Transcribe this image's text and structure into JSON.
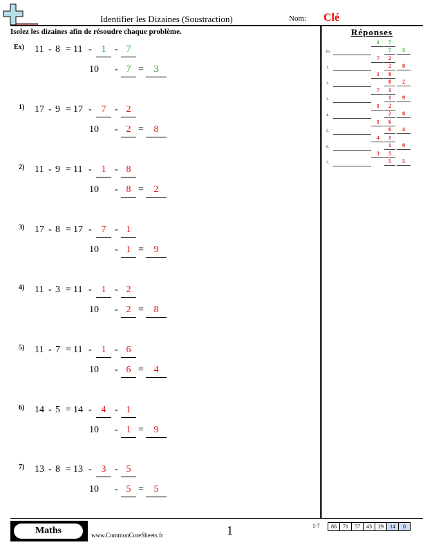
{
  "header": {
    "title": "Identifier les Dizaines (Soustraction)",
    "name_label": "Nom:",
    "name_value": "Clé",
    "logo_icon": "plus-minus-icon"
  },
  "instructions": "Isolez les dizaines afin de résoudre chaque problème.",
  "colors": {
    "example_answer": "#1aa51a",
    "key_answer": "#e01010"
  },
  "problems": [
    {
      "label": "Ex)",
      "a": "11",
      "b": "8",
      "tens_start": "11",
      "part1": "1",
      "part2": "7",
      "ten": "10",
      "result": "3",
      "example": true
    },
    {
      "label": "1)",
      "a": "17",
      "b": "9",
      "tens_start": "17",
      "part1": "7",
      "part2": "2",
      "ten": "10",
      "result": "8",
      "example": false
    },
    {
      "label": "2)",
      "a": "11",
      "b": "9",
      "tens_start": "11",
      "part1": "1",
      "part2": "8",
      "ten": "10",
      "result": "2",
      "example": false
    },
    {
      "label": "3)",
      "a": "17",
      "b": "8",
      "tens_start": "17",
      "part1": "7",
      "part2": "1",
      "ten": "10",
      "result": "9",
      "example": false
    },
    {
      "label": "4)",
      "a": "11",
      "b": "3",
      "tens_start": "11",
      "part1": "1",
      "part2": "2",
      "ten": "10",
      "result": "8",
      "example": false
    },
    {
      "label": "5)",
      "a": "11",
      "b": "7",
      "tens_start": "11",
      "part1": "1",
      "part2": "6",
      "ten": "10",
      "result": "4",
      "example": false
    },
    {
      "label": "6)",
      "a": "14",
      "b": "5",
      "tens_start": "14",
      "part1": "4",
      "part2": "1",
      "ten": "10",
      "result": "9",
      "example": false
    },
    {
      "label": "7)",
      "a": "13",
      "b": "8",
      "tens_start": "13",
      "part1": "3",
      "part2": "5",
      "ten": "10",
      "result": "5",
      "example": false
    }
  ],
  "answers": {
    "title": "Réponses",
    "rows": [
      {
        "label": "Ex.",
        "p1": "1",
        "p2": "7",
        "sub": "7",
        "res": "3",
        "example": true
      },
      {
        "label": "1.",
        "p1": "7",
        "p2": "2",
        "sub": "2",
        "res": "8",
        "example": false
      },
      {
        "label": "2.",
        "p1": "1",
        "p2": "8",
        "sub": "8",
        "res": "2",
        "example": false
      },
      {
        "label": "3.",
        "p1": "7",
        "p2": "1",
        "sub": "1",
        "res": "9",
        "example": false
      },
      {
        "label": "4.",
        "p1": "1",
        "p2": "2",
        "sub": "2",
        "res": "8",
        "example": false
      },
      {
        "label": "5.",
        "p1": "1",
        "p2": "6",
        "sub": "6",
        "res": "4",
        "example": false
      },
      {
        "label": "6.",
        "p1": "4",
        "p2": "1",
        "sub": "1",
        "res": "9",
        "example": false
      },
      {
        "label": "7.",
        "p1": "3",
        "p2": "5",
        "sub": "5",
        "res": "5",
        "example": false
      }
    ]
  },
  "footer": {
    "subject": "Maths",
    "site": "www.CommonCoreSheets.fr",
    "page": "1",
    "score_range": "1-7",
    "scores": [
      "86",
      "71",
      "57",
      "43",
      "29",
      "14",
      "0"
    ],
    "highlighted_scores": [
      "14",
      "0"
    ]
  }
}
